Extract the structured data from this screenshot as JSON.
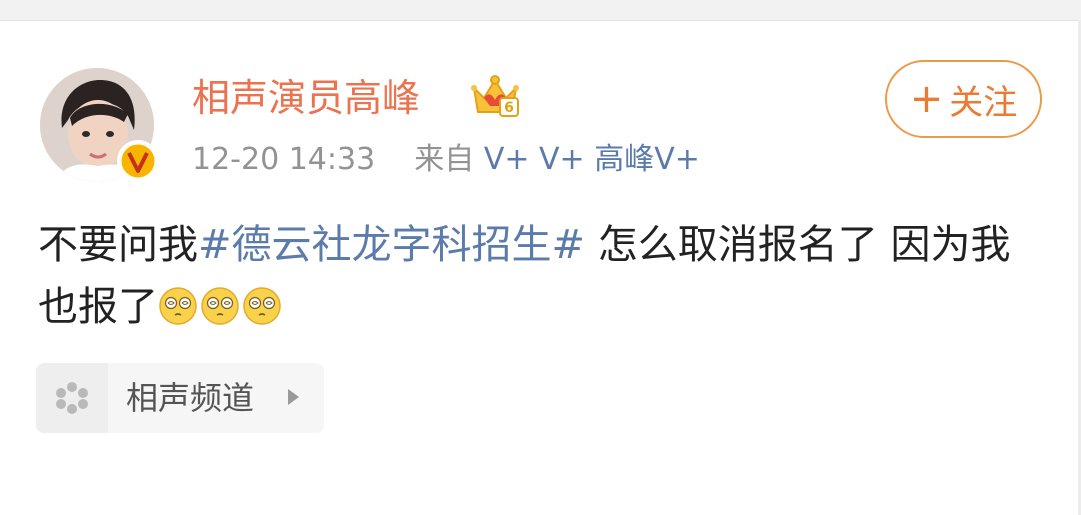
{
  "post": {
    "author": {
      "name": "相声演员高峰",
      "avatar_icon": "child-portrait-avatar",
      "verified_icon": "yellow-v-verified-icon",
      "member_icon": "crown-vip-level-6-icon"
    },
    "timestamp": "12-20 14:33",
    "source_prefix": "来自",
    "source_name": "V+ V+ 高峰V+",
    "follow_plus": "+",
    "follow_label": "关注",
    "content": {
      "text_before": "不要问我",
      "hashtag": "#德云社龙字科招生#",
      "text_after": " 怎么取消报名了 因为我也报了",
      "emoji_name": "dizzy-face-emoji",
      "emoji_count": 3
    },
    "channel": {
      "label": "相声频道",
      "icon": "dots-channel-icon",
      "arrow_icon": "triangle-right-icon"
    }
  },
  "colors": {
    "username": "#eb7350",
    "link": "#5b7baa",
    "follow_border": "#eb9a4a",
    "meta": "#939393"
  }
}
